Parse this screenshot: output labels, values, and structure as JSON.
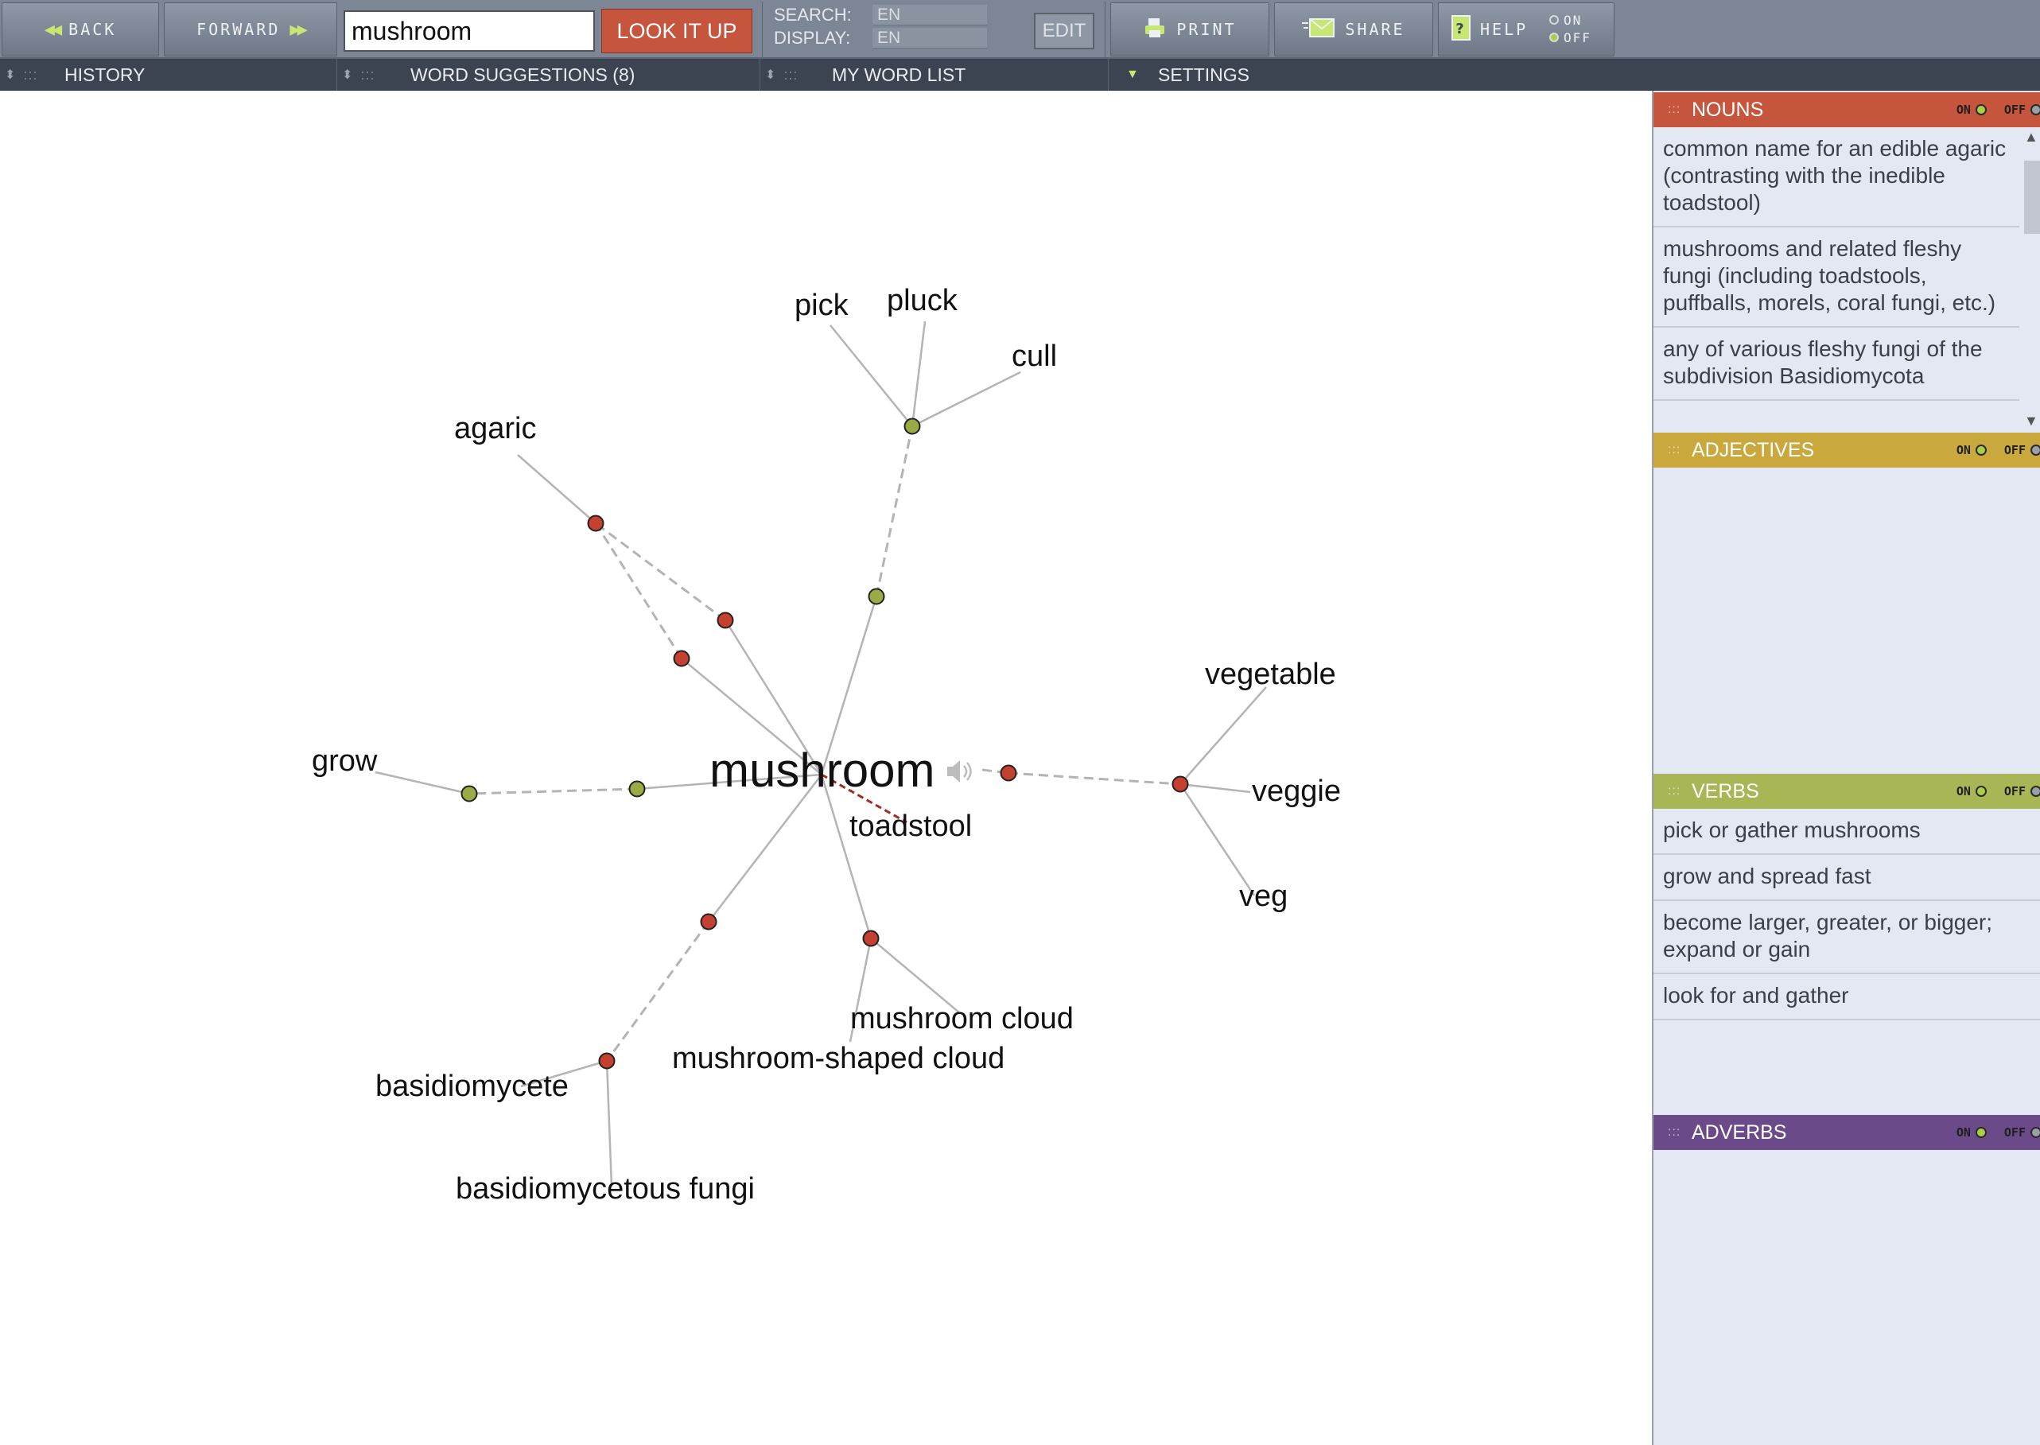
{
  "toolbar": {
    "back_label": "Back",
    "forward_label": "Forward",
    "search_value": "mushroom",
    "lookup_label": "LOOK IT UP",
    "search_lang_label": "SEARCH:",
    "search_lang_value": "EN",
    "display_lang_label": "DISPLAY:",
    "display_lang_value": "EN",
    "edit_label": "EDIT",
    "print_label": "Print",
    "share_label": "Share",
    "help_label": "Help",
    "help_on_label": "ON",
    "help_off_label": "OFF"
  },
  "panels": {
    "history": "HISTORY",
    "suggestions": "WORD SUGGESTIONS (8)",
    "word_list": "MY WORD LIST",
    "settings": "SETTINGS"
  },
  "graph": {
    "center": "mushroom",
    "labels": {
      "pick": "pick",
      "pluck": "pluck",
      "cull": "cull",
      "agaric": "agaric",
      "vegetable": "vegetable",
      "veggie": "veggie",
      "veg": "veg",
      "grow": "grow",
      "toadstool": "toadstool",
      "mushroom_cloud": "mushroom cloud",
      "mushroom_shaped_cloud": "mushroom-shaped cloud",
      "basidiomycete": "basidiomycete",
      "basidiomycetous_fungi": "basidiomycetous fungi"
    },
    "colors": {
      "noun_node": "#c5412f",
      "verb_node": "#9aab45",
      "edge": "#b4b4b4",
      "antonym_edge": "#a32c1e"
    }
  },
  "definitions": {
    "switch_on": "ON",
    "switch_off": "OFF",
    "nouns": {
      "title": "NOUNS",
      "color": "#c5553d",
      "items": [
        "common name for an edible agaric (contrasting with the inedible toadstool)",
        "mushrooms and related fleshy fungi (including toadstools, puffballs, morels, coral fungi, etc.)",
        "any of various fleshy fungi of the subdivision Basidiomycota"
      ]
    },
    "adjectives": {
      "title": "ADJECTIVES",
      "color": "#c9a83e",
      "items": []
    },
    "verbs": {
      "title": "VERBS",
      "color": "#a8b656",
      "items": [
        "pick or gather mushrooms",
        "grow and spread fast",
        "become larger, greater, or bigger; expand or gain",
        "look for and gather"
      ]
    },
    "adverbs": {
      "title": "ADVERBS",
      "color": "#6b4a8a",
      "items": []
    }
  }
}
